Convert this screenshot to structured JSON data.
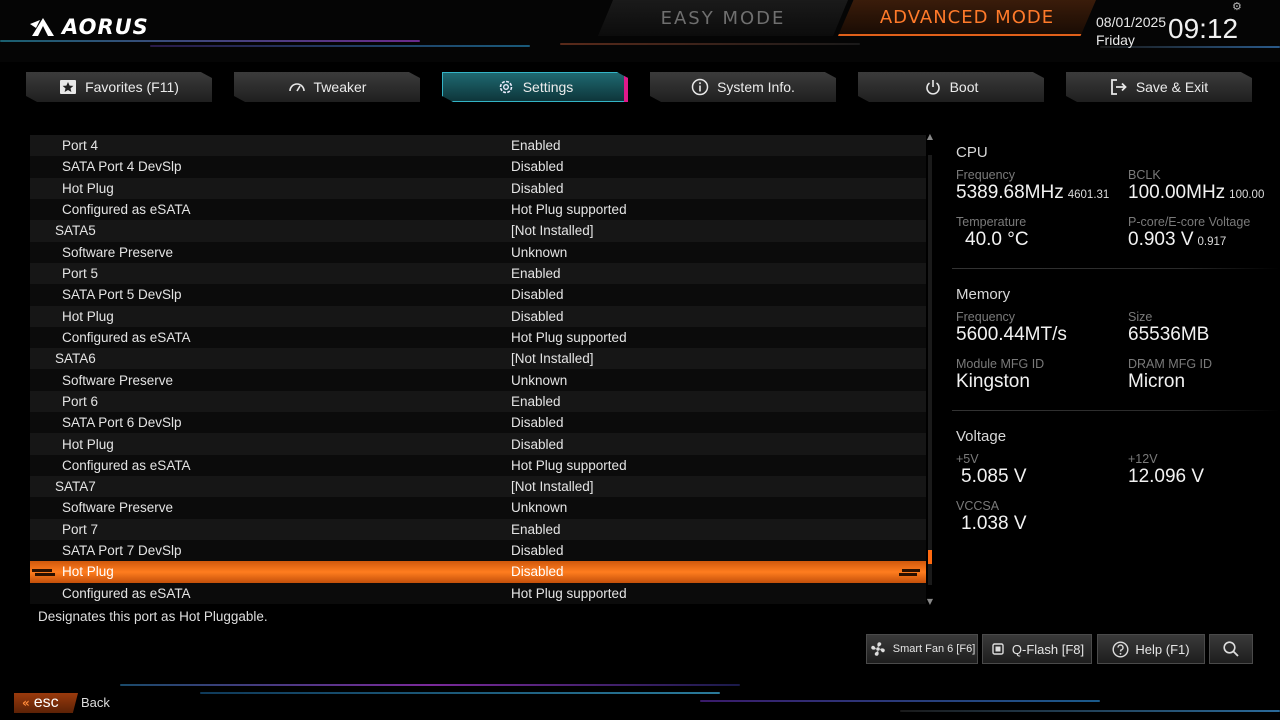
{
  "header": {
    "brand": "AORUS",
    "mode_easy": "EASY MODE",
    "mode_advanced": "ADVANCED MODE",
    "date": "08/01/2025",
    "day": "Friday",
    "time": "09:12"
  },
  "tabs": [
    {
      "label": "Favorites (F11)",
      "icon": "star-icon"
    },
    {
      "label": "Tweaker",
      "icon": "speedometer-icon"
    },
    {
      "label": "Settings",
      "icon": "gear-icon",
      "active": true
    },
    {
      "label": "System Info.",
      "icon": "info-icon"
    },
    {
      "label": "Boot",
      "icon": "power-icon"
    },
    {
      "label": "Save & Exit",
      "icon": "exit-icon"
    }
  ],
  "list": {
    "rows": [
      {
        "label": "Port 4",
        "value": "Enabled"
      },
      {
        "label": "SATA Port 4 DevSlp",
        "value": "Disabled"
      },
      {
        "label": "Hot Plug",
        "value": "Disabled"
      },
      {
        "label": "Configured as eSATA",
        "value": "Hot Plug supported"
      },
      {
        "label": "SATA5",
        "value": "[Not Installed]"
      },
      {
        "label": "Software Preserve",
        "value": "Unknown"
      },
      {
        "label": "Port 5",
        "value": "Enabled"
      },
      {
        "label": "SATA Port 5 DevSlp",
        "value": "Disabled"
      },
      {
        "label": "Hot Plug",
        "value": "Disabled"
      },
      {
        "label": "Configured as eSATA",
        "value": "Hot Plug supported"
      },
      {
        "label": "SATA6",
        "value": "[Not Installed]"
      },
      {
        "label": "Software Preserve",
        "value": "Unknown"
      },
      {
        "label": "Port 6",
        "value": "Enabled"
      },
      {
        "label": "SATA Port 6 DevSlp",
        "value": "Disabled"
      },
      {
        "label": "Hot Plug",
        "value": "Disabled"
      },
      {
        "label": "Configured as eSATA",
        "value": "Hot Plug supported"
      },
      {
        "label": "SATA7",
        "value": "[Not Installed]"
      },
      {
        "label": "Software Preserve",
        "value": "Unknown"
      },
      {
        "label": "Port 7",
        "value": "Enabled"
      },
      {
        "label": "SATA Port 7 DevSlp",
        "value": "Disabled"
      },
      {
        "label": "Hot Plug",
        "value": "Disabled"
      },
      {
        "label": "Configured as eSATA",
        "value": "Hot Plug supported"
      }
    ],
    "selected_index": 20,
    "scroll_position": 0.95
  },
  "hint": "Designates this port as Hot Pluggable.",
  "cpu": {
    "title": "CPU",
    "frequency_label": "Frequency",
    "frequency": "5389.68MHz",
    "frequency_sub": "4601.31",
    "bclk_label": "BCLK",
    "bclk": "100.00MHz",
    "bclk_sub": "100.00",
    "temp_label": "Temperature",
    "temp": "40.0 °C",
    "voltage_label": "P-core/E-core Voltage",
    "voltage": "0.903 V",
    "voltage_sub": "0.917"
  },
  "memory": {
    "title": "Memory",
    "frequency_label": "Frequency",
    "frequency": "5600.44MT/s",
    "size_label": "Size",
    "size": "65536MB",
    "module_label": "Module MFG ID",
    "module": "Kingston",
    "dram_label": "DRAM MFG ID",
    "dram": "Micron"
  },
  "voltage": {
    "title": "Voltage",
    "v5_label": "+5V",
    "v5": "5.085 V",
    "v12_label": "+12V",
    "v12": "12.096 V",
    "vccsa_label": "VCCSA",
    "vccsa": "1.038 V"
  },
  "bottom": {
    "smart_fan": "Smart Fan 6 [F6]",
    "qflash": "Q-Flash [F8]",
    "help": "Help (F1)",
    "esc": "esc",
    "back": "Back"
  },
  "colors": {
    "accent_orange": "#ff6a10",
    "accent_teal": "#1f6a73",
    "accent_magenta": "#e0188a"
  }
}
